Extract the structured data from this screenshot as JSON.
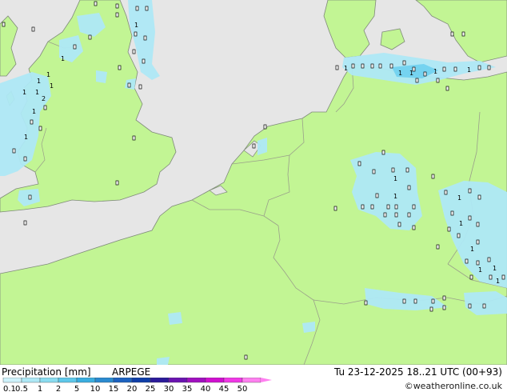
{
  "title": "Precipitation [mm]",
  "model": "ARPEGE",
  "valid_time": "Tu 23-12-2025 18..21 UTC (00+93)",
  "credit": "©weatheronline.co.uk",
  "colors": {
    "sea": "#e6e6e6",
    "land": "#c2f594",
    "border": "#9aa08a",
    "coast": "#7f8a7a",
    "precip_light": "#aee8f5",
    "precip_medium": "#6fd0ef"
  },
  "legend": {
    "ticks": [
      "0.1",
      "0.5",
      "1",
      "2",
      "5",
      "10",
      "15",
      "20",
      "25",
      "30",
      "35",
      "40",
      "45",
      "50"
    ],
    "colors": [
      "#cef2fb",
      "#aee8f5",
      "#8adcf0",
      "#5ec8ea",
      "#3aaee0",
      "#2a8ad0",
      "#1c62c0",
      "#0e3ea8",
      "#2a1a9a",
      "#6a14b0",
      "#a010c0",
      "#d010d0",
      "#f038e6",
      "#ff80f0"
    ]
  },
  "map_labels": [
    {
      "text": "1"
    },
    {
      "text": "1"
    },
    {
      "text": "1"
    },
    {
      "text": "1"
    },
    {
      "text": "1"
    },
    {
      "text": "2"
    },
    {
      "text": "1"
    },
    {
      "text": "1"
    },
    {
      "text": "1"
    },
    {
      "text": "1"
    },
    {
      "text": "1"
    },
    {
      "text": "1"
    },
    {
      "text": "1"
    },
    {
      "text": "1"
    },
    {
      "text": "1"
    },
    {
      "text": "1"
    },
    {
      "text": "1"
    },
    {
      "text": "1"
    },
    {
      "text": "1"
    },
    {
      "text": "1"
    },
    {
      "text": "1"
    },
    {
      "text": "1"
    },
    {
      "text": "1"
    }
  ]
}
